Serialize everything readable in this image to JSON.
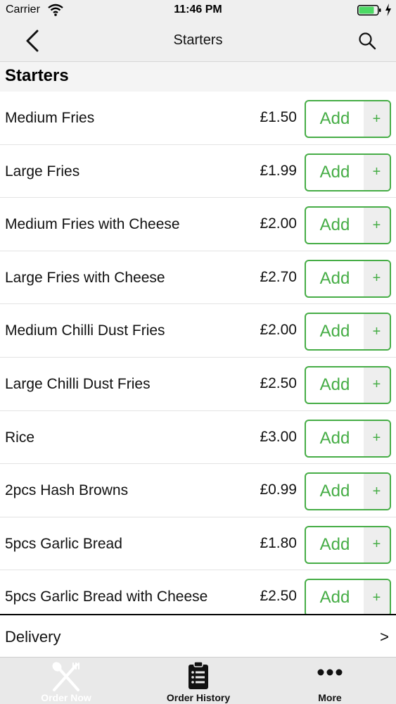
{
  "status_bar": {
    "carrier": "Carrier",
    "time": "11:46 PM"
  },
  "nav": {
    "title": "Starters",
    "back_icon": "chevron-left-icon",
    "search_icon": "search-icon"
  },
  "section": {
    "title": "Starters"
  },
  "add_label": "Add",
  "add_plus": "+",
  "items": [
    {
      "name": "Medium Fries",
      "price": "£1.50"
    },
    {
      "name": "Large Fries",
      "price": "£1.99"
    },
    {
      "name": "Medium Fries with Cheese",
      "price": "£2.00"
    },
    {
      "name": "Large Fries with Cheese",
      "price": "£2.70"
    },
    {
      "name": "Medium Chilli Dust Fries",
      "price": "£2.00"
    },
    {
      "name": "Large Chilli Dust Fries",
      "price": "£2.50"
    },
    {
      "name": "Rice",
      "price": "£3.00"
    },
    {
      "name": "2pcs Hash Browns",
      "price": "£0.99"
    },
    {
      "name": "5pcs Garlic Bread",
      "price": "£1.80"
    },
    {
      "name": "5pcs Garlic Bread with Cheese",
      "price": "£2.50"
    }
  ],
  "delivery": {
    "label": "Delivery",
    "arrow": ">"
  },
  "tabs": [
    {
      "label": "Order Now",
      "icon": "fork-spoon-icon",
      "active": true
    },
    {
      "label": "Order History",
      "icon": "clipboard-icon",
      "active": false
    },
    {
      "label": "More",
      "icon": "more-dots-icon",
      "active": false
    }
  ],
  "colors": {
    "accent": "#46ad46",
    "bar_background": "#efefef",
    "battery": "#4cd964"
  }
}
